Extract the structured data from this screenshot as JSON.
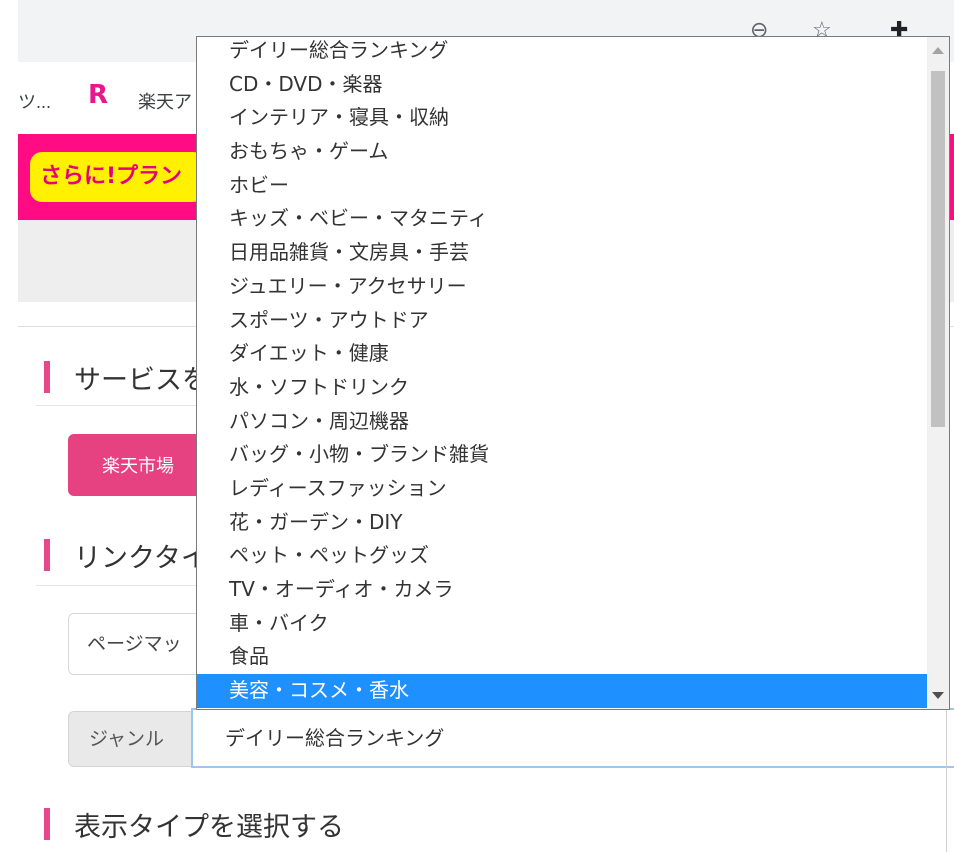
{
  "browser": {
    "bookmarks": {
      "item1": "ツ...",
      "rakuten_mark": "R",
      "item2": "楽天ア"
    },
    "icons": [
      "zoom-icon",
      "star-icon",
      "extensions-icon"
    ]
  },
  "banner": {
    "text": "さらに!プラン"
  },
  "sections": {
    "service": {
      "title": "サービスを"
    },
    "link_type": {
      "title": "リンクタイ"
    },
    "display_type": {
      "title": "表示タイプを選択する"
    }
  },
  "buttons": {
    "rakuten_ichiba": "楽天市場"
  },
  "page_select": {
    "value": "ページマッ"
  },
  "genre": {
    "label": "ジャンル",
    "value": "デイリー総合ランキング"
  },
  "dropdown": {
    "options": [
      "デイリー総合ランキング",
      "CD・DVD・楽器",
      "インテリア・寝具・収納",
      "おもちゃ・ゲーム",
      "ホビー",
      "キッズ・ベビー・マタニティ",
      "日用品雑貨・文房具・手芸",
      "ジュエリー・アクセサリー",
      "スポーツ・アウトドア",
      "ダイエット・健康",
      "水・ソフトドリンク",
      "パソコン・周辺機器",
      "バッグ・小物・ブランド雑貨",
      "レディースファッション",
      "花・ガーデン・DIY",
      "ペット・ペットグッズ",
      "TV・オーディオ・カメラ",
      "車・バイク",
      "食品",
      "美容・コスメ・香水"
    ],
    "selected": "美容・コスメ・香水"
  },
  "colors": {
    "brand_pink": "#ff0c85",
    "accent_bar": "#e8488a",
    "button_pink": "#e64180",
    "selection_blue": "#1e90ff",
    "banner_yellow": "#fff100"
  }
}
